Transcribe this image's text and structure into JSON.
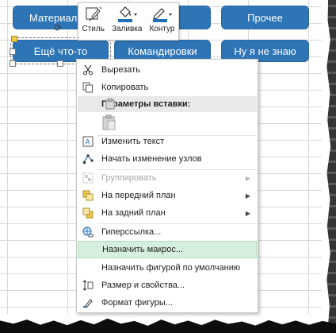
{
  "sheet": {
    "buttons": {
      "materials": "Материал",
      "other": "Прочее",
      "something": "Ещё что-то",
      "trips": "Командировки",
      "dontknow": "Ну я не знаю"
    }
  },
  "mini_toolbar": {
    "style": "Стиль",
    "fill": "Заливка",
    "outline": "Контур",
    "accent": "#1f6fb5"
  },
  "menu": {
    "cut": "Вырезать",
    "copy": "Копировать",
    "paste_header": "Параметры вставки:",
    "edit_text": "Изменить текст",
    "edit_points": "Начать изменение узлов",
    "group": "Группировать",
    "bring_front": "На передний план",
    "send_back": "На задний план",
    "hyperlink": "Гиперссылка...",
    "assign_macro": "Назначить макрос...",
    "default_shape": "Назначить фигурой по умолчанию",
    "size_props": "Размер и свойства...",
    "format_shape": "Формат фигуры...",
    "highlight_color": "#d6efdc"
  }
}
